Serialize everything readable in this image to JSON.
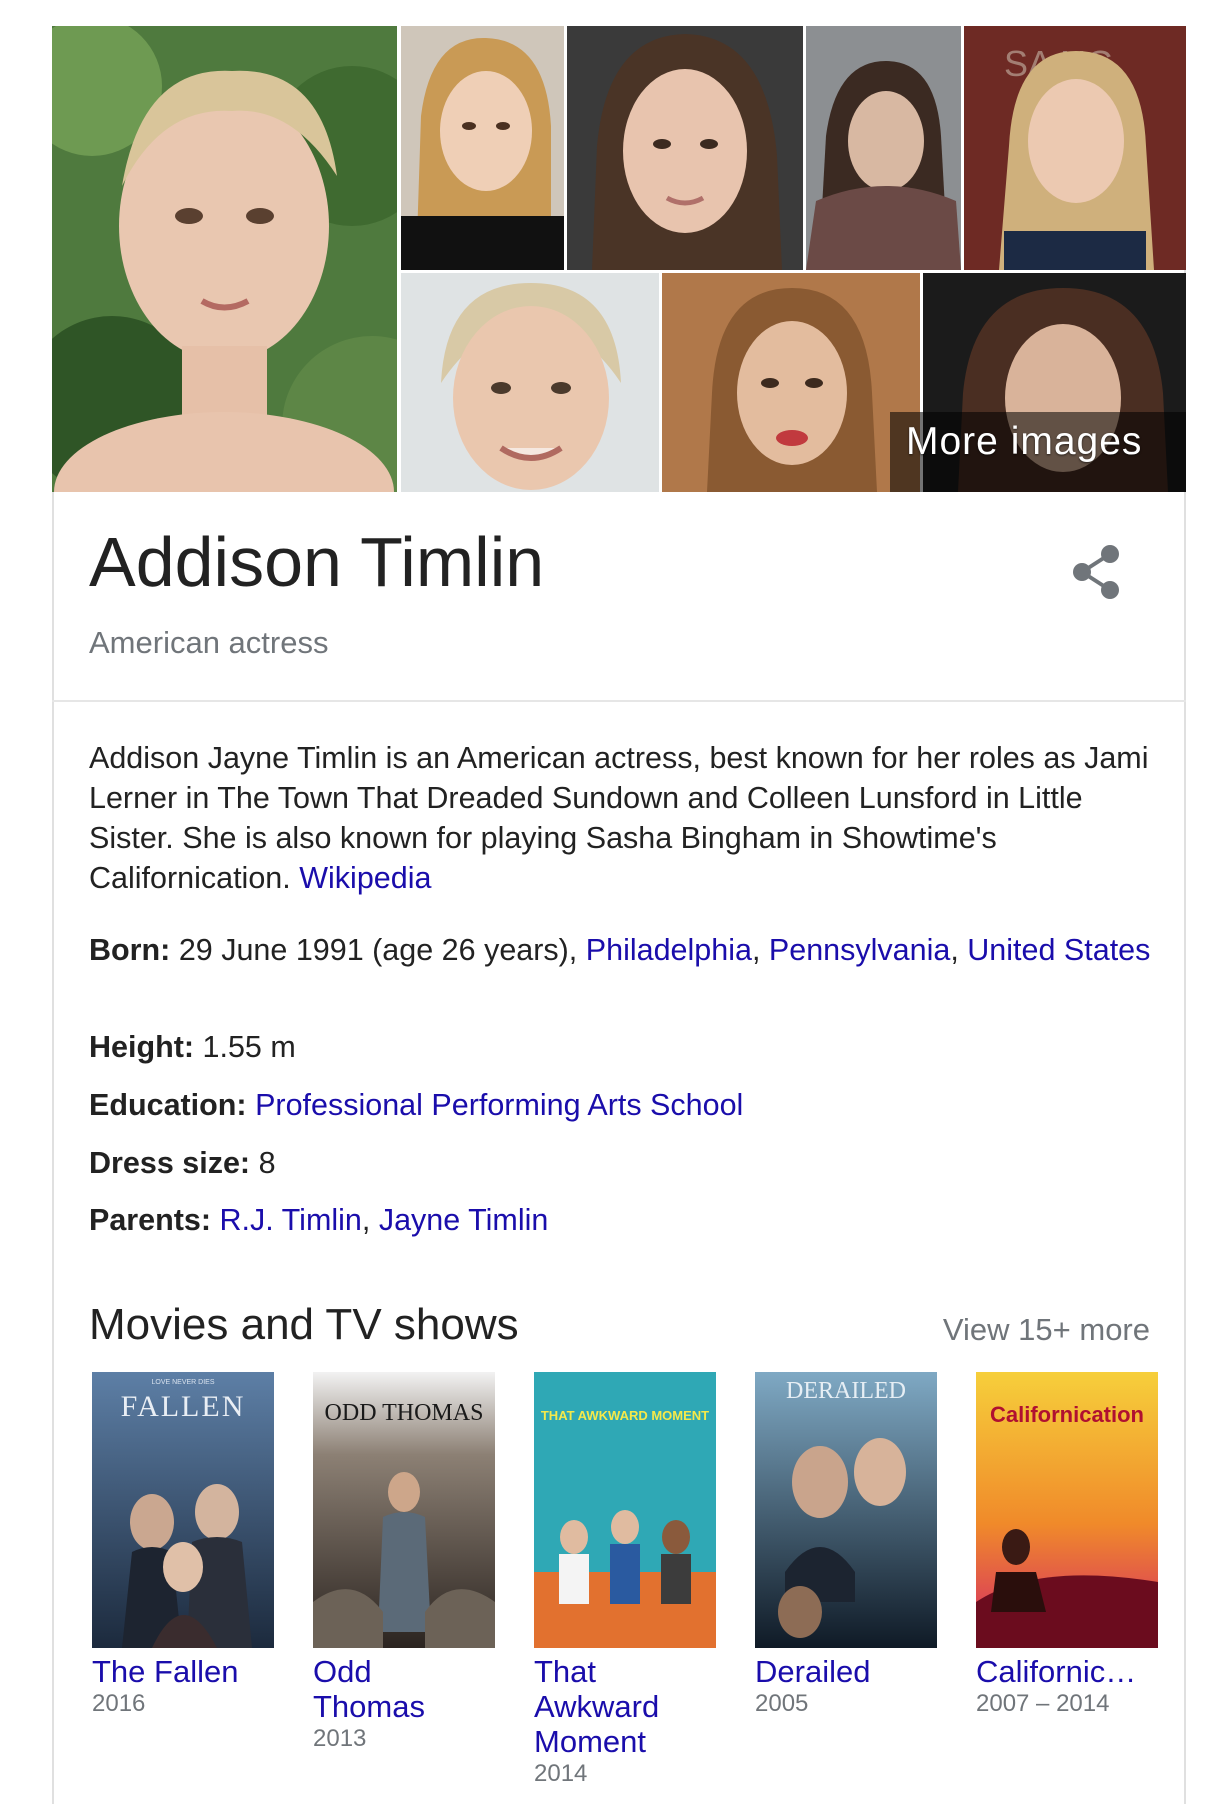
{
  "gallery": {
    "more_label": "More images"
  },
  "header": {
    "title": "Addison Timlin",
    "subtitle": "American actress"
  },
  "description": {
    "text": "Addison Jayne Timlin is an American actress, best known for her roles as Jami Lerner in The Town That Dreaded Sundown and Colleen Lunsford in Little Sister. She is also known for playing Sasha Bingham in Showtime's Californication.",
    "source_link": "Wikipedia"
  },
  "facts": {
    "born": {
      "label": "Born:",
      "value": "29 June 1991 (age 26 years),",
      "links": [
        "Philadelphia",
        "Pennsylvania",
        "United States"
      ]
    },
    "height": {
      "label": "Height:",
      "value": "1.55 m"
    },
    "education": {
      "label": "Education:",
      "link": "Professional Performing Arts School"
    },
    "dress_size": {
      "label": "Dress size:",
      "value": "8"
    },
    "parents": {
      "label": "Parents:",
      "links": [
        "R.J. Timlin",
        "Jayne Timlin"
      ]
    }
  },
  "movies": {
    "section_title": "Movies and TV shows",
    "view_more": "View 15+ more",
    "items": [
      {
        "title_lines": [
          "The Fallen"
        ],
        "year": "2016",
        "poster_text": "FALLEN",
        "poster_small": "LOVE NEVER DIES"
      },
      {
        "title_lines": [
          "Odd",
          "Thomas"
        ],
        "year": "2013",
        "poster_text": "ODD THOMAS"
      },
      {
        "title_lines": [
          "That",
          "Awkward",
          "Moment"
        ],
        "year": "2014",
        "poster_text": "THAT AWKWARD MOMENT"
      },
      {
        "title_lines": [
          "Derailed"
        ],
        "year": "2005",
        "poster_text": "DERAILED"
      },
      {
        "title_lines": [
          "Californic…"
        ],
        "year": "2007 – 2014",
        "poster_text": "Californication"
      }
    ]
  },
  "colors": {
    "link": "#1a0dab",
    "muted": "#70757a",
    "text": "#222222"
  }
}
